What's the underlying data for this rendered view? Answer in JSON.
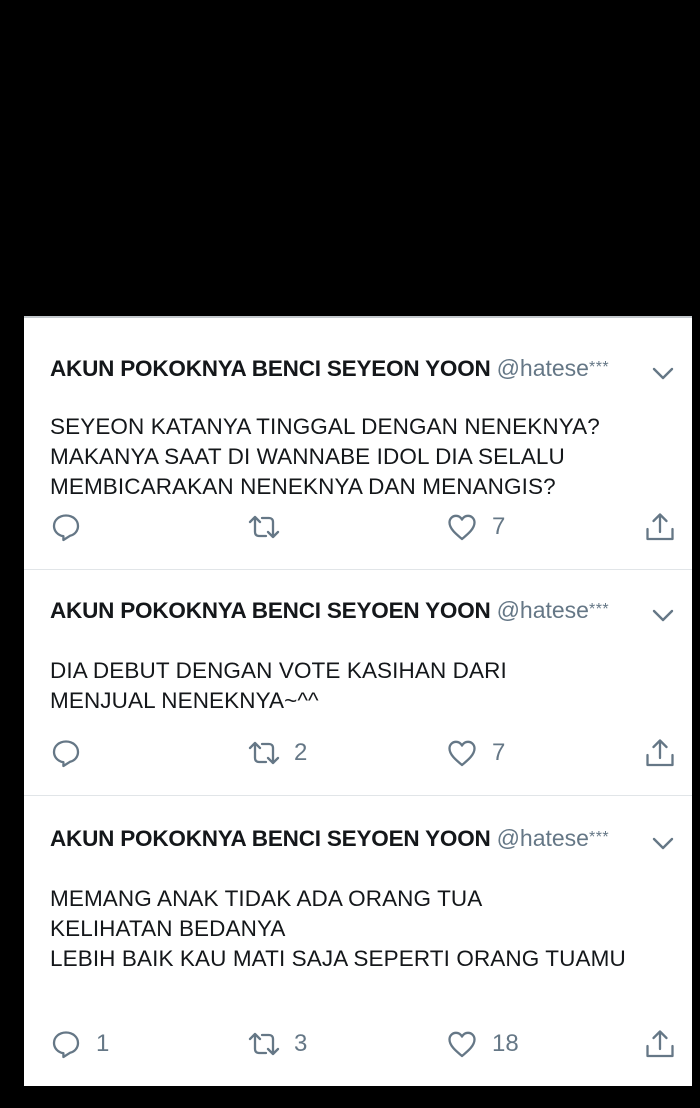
{
  "tweets": [
    {
      "author": "AKUN POKOKNYA BENCI SEYEON YOON",
      "handle": "@hatese",
      "handle_mask": "***",
      "lines": [
        "SEYEON KATANYA TINGGAL DENGAN NENEKNYA?",
        "MAKANYA SAAT DI WANNABE IDOL DIA SELALU",
        "MEMBICARAKAN NENEKNYA DAN MENANGIS?"
      ],
      "replies": "",
      "retweets": "",
      "likes": "7"
    },
    {
      "author": "AKUN POKOKNYA BENCI SEYOEN YOON",
      "handle": "@hatese",
      "handle_mask": "***",
      "lines": [
        "DIA DEBUT DENGAN VOTE KASIHAN DARI",
        "MENJUAL NENEKNYA~^^"
      ],
      "replies": "",
      "retweets": "2",
      "likes": "7"
    },
    {
      "author": "AKUN POKOKNYA BENCI SEYOEN YOON",
      "handle": "@hatese",
      "handle_mask": "***",
      "lines": [
        "MEMANG ANAK TIDAK ADA ORANG TUA",
        "KELIHATAN BEDANYA",
        "LEBIH BAIK KAU MATI SAJA SEPERTI ORANG TUAMU"
      ],
      "replies": "1",
      "retweets": "3",
      "likes": "18"
    }
  ],
  "icons": {
    "reply": "reply-icon",
    "retweet": "retweet-icon",
    "like": "heart-icon",
    "share": "share-icon",
    "menu": "chevron-down-icon"
  },
  "colors": {
    "background": "#000000",
    "card": "#ffffff",
    "text": "#14171a",
    "secondary": "#657786",
    "divider": "#e1e5e8"
  }
}
